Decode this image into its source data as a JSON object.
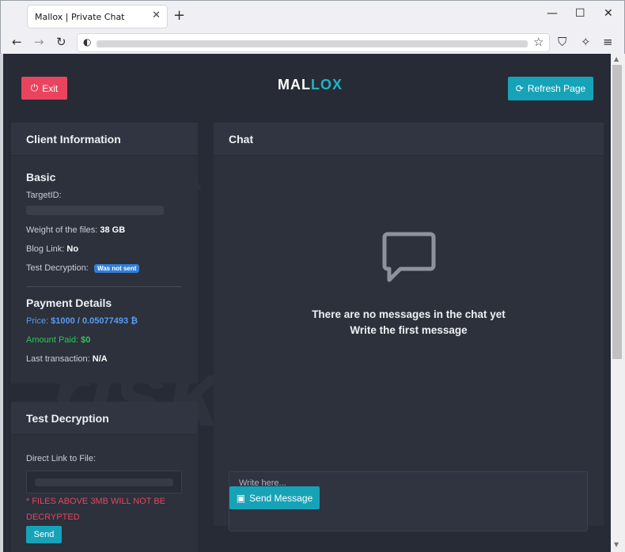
{
  "browser": {
    "tab_title": "Mallox | Private Chat",
    "tab_close": "✕",
    "new_tab": "+",
    "minimize": "—",
    "maximize": "☐",
    "close": "✕"
  },
  "header": {
    "exit_label": "Exit",
    "brand_first": "MAL",
    "brand_second": "LOX",
    "refresh_label": "Refresh Page"
  },
  "client_info": {
    "title": "Client Information",
    "basic_title": "Basic",
    "target_label": "TargetID:",
    "weight_label": "Weight of the files:",
    "weight_value": "38 GB",
    "blog_label": "Blog Link:",
    "blog_value": "No",
    "test_label": "Test Decryption:",
    "test_badge": "Was not sent",
    "payment_title": "Payment Details",
    "price_label": "Price:",
    "price_value": "$1000 / 0.05077493 ₿",
    "paid_label": "Amount Paid:",
    "paid_value": "$0",
    "last_tx_label": "Last transaction:",
    "last_tx_value": "N/A"
  },
  "test_decryption": {
    "title": "Test Decryption",
    "link_label": "Direct Link to File:",
    "warning": "* FILES ABOVE 3MB WILL NOT BE DECRYPTED",
    "send_label": "Send"
  },
  "chat": {
    "title": "Chat",
    "empty_line1": "There are no messages in the chat yet",
    "empty_line2": "Write the first message",
    "input_placeholder": "Write here...",
    "send_label": "Send Message"
  },
  "colors": {
    "page_bg": "#262b36",
    "card_bg": "#2c313c",
    "danger": "#e8445e",
    "info": "#16a3b8",
    "accent": "#1fb3c6",
    "price": "#5a9cf0",
    "paid": "#2fc55c"
  }
}
